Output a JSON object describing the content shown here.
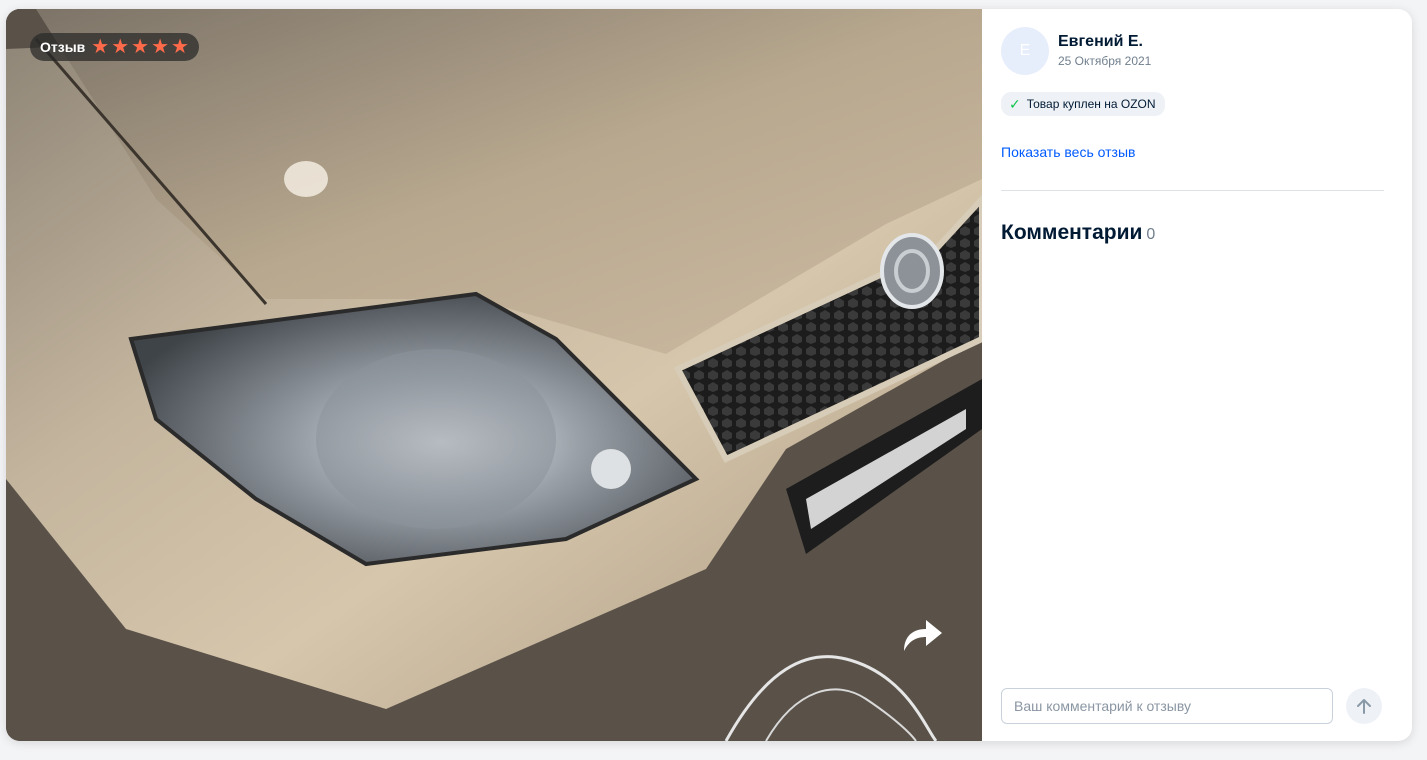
{
  "review": {
    "badge_label": "Отзыв",
    "rating": 5,
    "star_glyph": "★",
    "star_color": "#ff6b4a"
  },
  "author": {
    "initial": "Е",
    "name": "Евгений Е.",
    "date": "25 Октября 2021"
  },
  "purchase": {
    "check_icon": "✓",
    "label": "Товар куплен на OZON"
  },
  "links": {
    "show_full": "Показать весь отзыв"
  },
  "comments": {
    "title": "Комментарии",
    "count": "0",
    "input_placeholder": "Ваш комментарий к отзыву"
  },
  "colors": {
    "accent": "#005bff",
    "success": "#10c44c",
    "text": "#001a34"
  }
}
